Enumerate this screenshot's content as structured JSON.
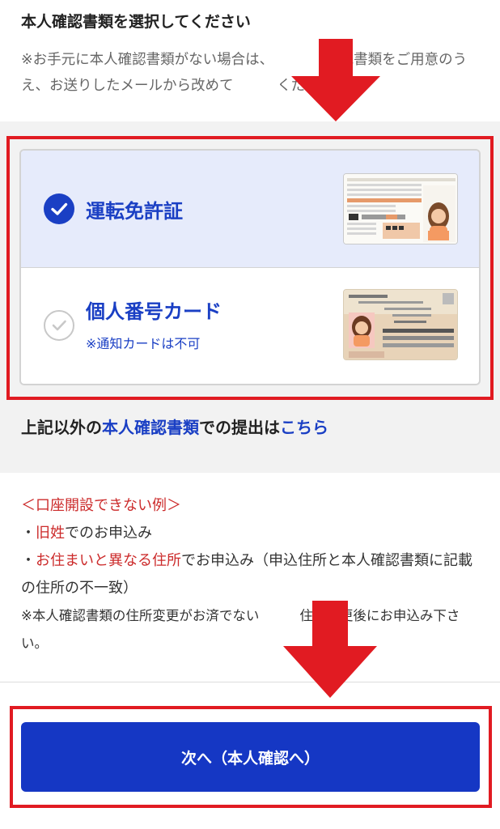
{
  "page": {
    "title": "本人確認書類を選択してください",
    "note_part1": "※お手元に本人確認書類がない場合は、",
    "note_part2": "確認書類をご用意のうえ、お送りしたメールから改めて",
    "note_part3": "ください。"
  },
  "options": [
    {
      "label": "運転免許証",
      "sub": "",
      "selected": true,
      "icon": "check-circle-filled-icon"
    },
    {
      "label": "個人番号カード",
      "sub": "※通知カードは不可",
      "selected": false,
      "icon": "check-circle-outline-icon"
    }
  ],
  "other": {
    "prefix": "上記以外の",
    "doc_link": "本人確認書類",
    "middle": "での提出は",
    "here_link": "こちら"
  },
  "examples": {
    "heading": "＜口座開設できない例＞",
    "bullet": "・",
    "item1_red": "旧姓",
    "item1_rest": "でのお申込み",
    "item2_red": "お住まいと異なる住所",
    "item2_rest": "でお申込み（申込住所と本人確認書類に記載の住所の不一致）",
    "note_a": "※本人確認書類の住所変更がお済でない",
    "note_b": "住所変更後にお申込み下さい。"
  },
  "button": {
    "label": "次へ（本人確認へ）"
  },
  "colors": {
    "accent": "#1a3fc4",
    "button": "#1537c4",
    "highlight": "#e11b22",
    "warning_text": "#cc2b2b"
  }
}
